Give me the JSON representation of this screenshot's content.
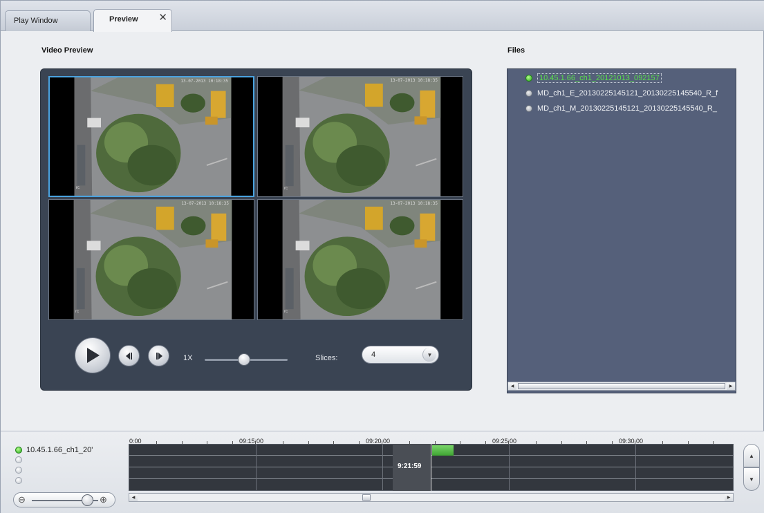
{
  "tabs": [
    {
      "label": "Play Window",
      "active": false
    },
    {
      "label": "Preview",
      "active": true,
      "close": "✕"
    }
  ],
  "video_preview": {
    "title": "Video Preview",
    "tiles": [
      {
        "timestamp": "13-07-2013 10:18:35",
        "selected": true
      },
      {
        "timestamp": "13-07-2013 10:18:35",
        "selected": false
      },
      {
        "timestamp": "13-07-2013 10:18:35",
        "selected": false
      },
      {
        "timestamp": "13-07-2013 10:18:35",
        "selected": false
      }
    ],
    "controls": {
      "play_icon": "play-icon",
      "step_back_icon": "step-back-icon",
      "step_forward_icon": "step-forward-icon",
      "speed": "1X",
      "slices_label": "Slices:",
      "slices_value": "4"
    }
  },
  "files": {
    "title": "Files",
    "items": [
      {
        "name": "10.45.1.66_ch1_20121013_092157",
        "active": true
      },
      {
        "name": "MD_ch1_E_20130225145121_20130225145540_R_f",
        "active": false
      },
      {
        "name": "MD_ch1_M_20130225145121_20130225145540_R_",
        "active": false
      }
    ]
  },
  "timeline": {
    "channels": [
      {
        "label": "10.45.1.66_ch1_20'",
        "active": true
      },
      {
        "label": "",
        "active": false
      },
      {
        "label": "",
        "active": false
      },
      {
        "label": "",
        "active": false
      }
    ],
    "ticks": [
      "0:00",
      "09:15:00",
      "09:20:00",
      "09:25:00",
      "09:30:00"
    ],
    "playhead": "9:21:59",
    "colors": {
      "recording": "#5cc04c",
      "background": "#33373e"
    }
  }
}
